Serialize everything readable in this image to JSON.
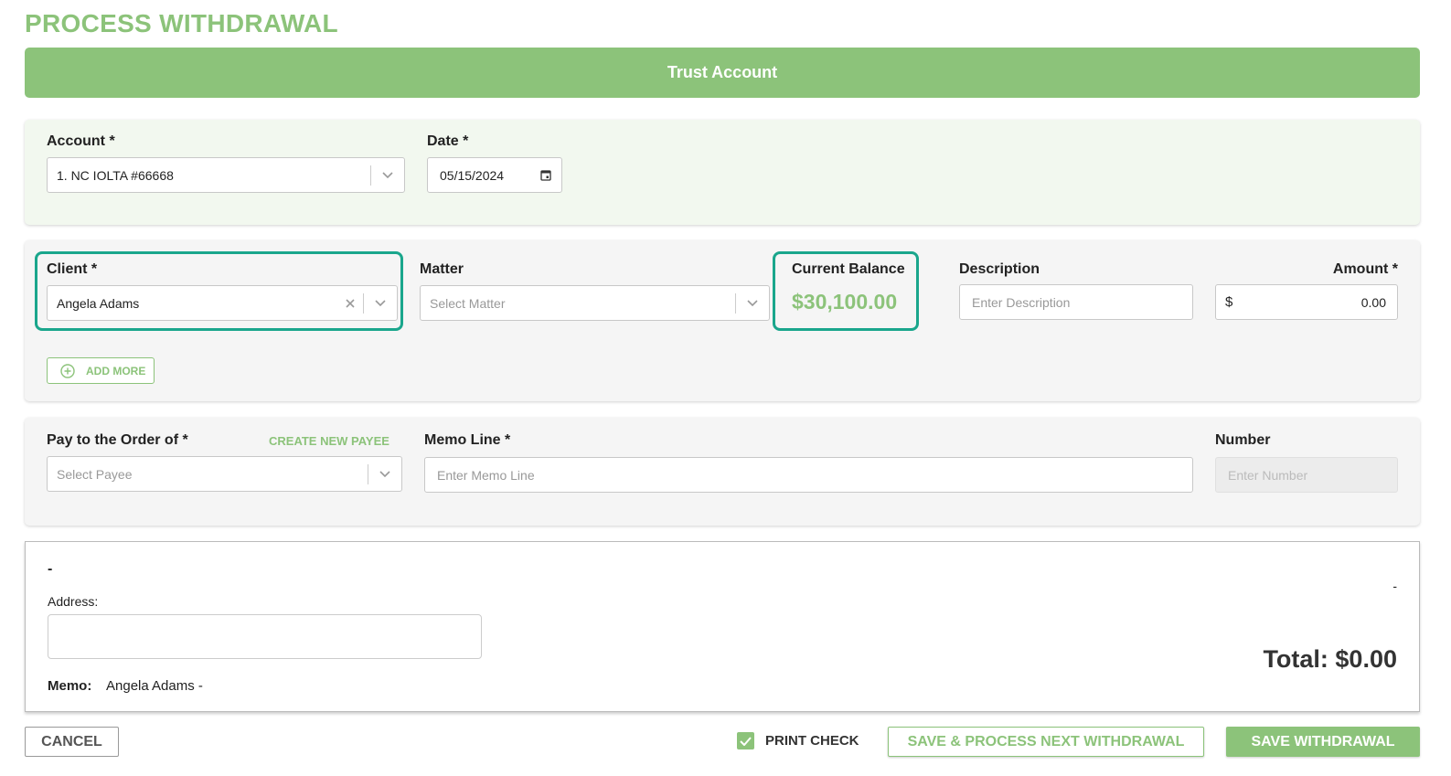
{
  "page": {
    "title": "PROCESS WITHDRAWAL",
    "banner": "Trust Account"
  },
  "colors": {
    "accent": "#8cc37a",
    "highlight": "#1aa68c"
  },
  "account_section": {
    "account_label": "Account *",
    "account_value": "1. NC IOLTA #66668",
    "date_label": "Date *",
    "date_value": "05/15/2024"
  },
  "client_section": {
    "client_label": "Client *",
    "client_value": "Angela Adams",
    "matter_label": "Matter",
    "matter_placeholder": "Select Matter",
    "balance_label": "Current Balance",
    "balance_value": "$30,100.00",
    "description_label": "Description",
    "description_placeholder": "Enter Description",
    "amount_label": "Amount *",
    "amount_currency": "$",
    "amount_value": "0.00",
    "add_more_label": "ADD MORE"
  },
  "payee_section": {
    "payee_label": "Pay to the Order of *",
    "create_payee_label": "CREATE NEW PAYEE",
    "payee_placeholder": "Select Payee",
    "memo_label": "Memo Line *",
    "memo_placeholder": "Enter Memo Line",
    "number_label": "Number",
    "number_placeholder": "Enter Number"
  },
  "check_preview": {
    "payee_name": "-",
    "right_dash": "-",
    "address_label": "Address:",
    "memo_label": "Memo:",
    "memo_value": "Angela Adams -",
    "total": "Total: $0.00"
  },
  "footer": {
    "cancel_label": "CANCEL",
    "print_check_label": "PRINT CHECK",
    "print_check_checked": true,
    "save_next_label": "SAVE & PROCESS NEXT WITHDRAWAL",
    "save_label": "SAVE WITHDRAWAL"
  },
  "icons": {
    "chevron": "chevron-down-icon",
    "calendar": "calendar-icon",
    "clear": "close-icon",
    "add": "plus-circle-icon",
    "check": "checkmark-icon"
  }
}
